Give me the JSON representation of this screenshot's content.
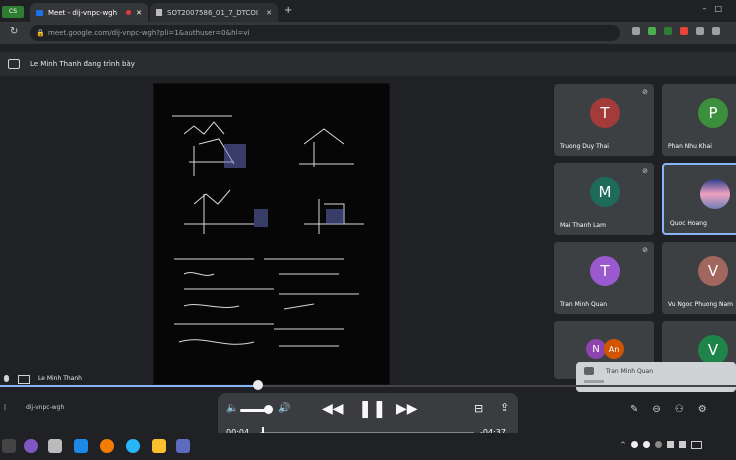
{
  "browser": {
    "status_chip": "CS",
    "tabs": [
      {
        "label": "Meet - dij-vnpc-wgh"
      },
      {
        "label": "SOT2007586_01_7_DTCOI"
      }
    ],
    "url": "meet.google.com/dij-vnpc-wgh?pli=1&authuser=0&hl=vi"
  },
  "meet": {
    "presenting_label": "Le Minh Thanh đang trình bày",
    "presenter_name": "Le Minh Thanh",
    "meeting_code": "dij-vnpc-wgh",
    "participants": [
      {
        "initial": "T",
        "name": "Truong Duy Thai",
        "color": "#a33b3b"
      },
      {
        "initial": "P",
        "name": "Phan Nhu Khai",
        "color": "#3c8f3c"
      },
      {
        "initial": "M",
        "name": "Mai Thanh Lam",
        "color": "#1f6b5a"
      },
      {
        "initial": "",
        "name": "Quoc Hoang",
        "color": "#6c7fb5"
      },
      {
        "initial": "T",
        "name": "Tran Minh Quan",
        "color": "#9b59d0"
      },
      {
        "initial": "V",
        "name": "Vu Ngoc Phuong Nam",
        "color": "#a1665e"
      },
      {
        "initial": "N",
        "name": "",
        "color": "#8e44ad"
      },
      {
        "initial": "An",
        "name": "",
        "color": "#d35400"
      },
      {
        "initial": "V",
        "name": "",
        "color": "#1e8449"
      }
    ],
    "toast_name": "Tran Minh Quan"
  },
  "video_player": {
    "elapsed": "00:04",
    "remaining": "-04:37",
    "progress_fraction": 0.015,
    "volume_fraction": 0.7
  }
}
